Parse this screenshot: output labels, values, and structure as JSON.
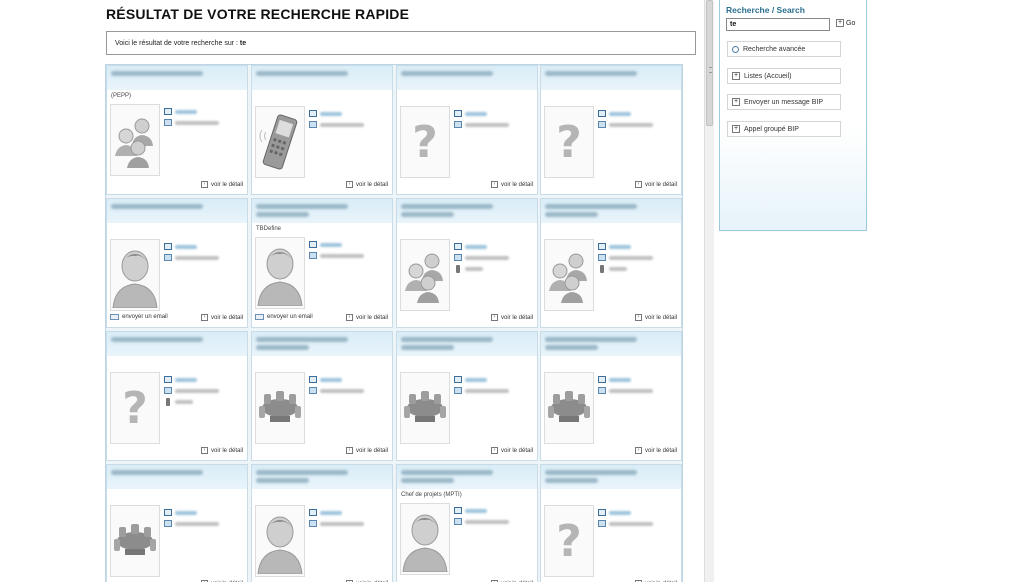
{
  "page_title": "RÉSULTAT DE VOTRE RECHERCHE RAPIDE",
  "search_info": {
    "prefix": "Voici le résultat de votre recherche sur :",
    "term": "te"
  },
  "sidebar": {
    "title": "Recherche / Search",
    "search_value": "te",
    "go_label": "Go",
    "buttons": [
      {
        "label": "Recherche avancée",
        "icon": "magnifier-icon"
      },
      {
        "label": "Listes (Accueil)",
        "icon": "plus-icon"
      },
      {
        "label": "Envoyer un message BIP",
        "icon": "plus-icon"
      },
      {
        "label": "Appel groupé BIP",
        "icon": "plus-icon"
      }
    ]
  },
  "detail_label": "voir le détail",
  "email_label": "envoyer un email",
  "cards": [
    {
      "role": "(PEPP)",
      "photo": "group",
      "has_email": false,
      "has_mobile": false
    },
    {
      "role": "",
      "photo": "phone",
      "has_email": false,
      "has_mobile": false
    },
    {
      "role": "",
      "photo": "unknown",
      "has_email": false,
      "has_mobile": false
    },
    {
      "role": "",
      "photo": "unknown",
      "has_email": false,
      "has_mobile": false
    },
    {
      "role": "",
      "photo": "person",
      "has_email": true,
      "has_mobile": false
    },
    {
      "role": "TBDefine",
      "photo": "person",
      "has_email": true,
      "has_mobile": false
    },
    {
      "role": "",
      "photo": "group",
      "has_email": false,
      "has_mobile": true
    },
    {
      "role": "",
      "photo": "group",
      "has_email": false,
      "has_mobile": true
    },
    {
      "role": "",
      "photo": "unknown",
      "has_email": false,
      "has_mobile": true
    },
    {
      "role": "",
      "photo": "room",
      "has_email": false,
      "has_mobile": false
    },
    {
      "role": "",
      "photo": "room",
      "has_email": false,
      "has_mobile": false
    },
    {
      "role": "",
      "photo": "room",
      "has_email": false,
      "has_mobile": false
    },
    {
      "role": "",
      "photo": "room",
      "has_email": false,
      "has_mobile": false
    },
    {
      "role": "",
      "photo": "person",
      "has_email": false,
      "has_mobile": false
    },
    {
      "role": "Chef de projets (MPTI)",
      "photo": "person",
      "has_email": false,
      "has_mobile": false
    },
    {
      "role": "",
      "photo": "unknown",
      "has_email": false,
      "has_mobile": false
    }
  ]
}
